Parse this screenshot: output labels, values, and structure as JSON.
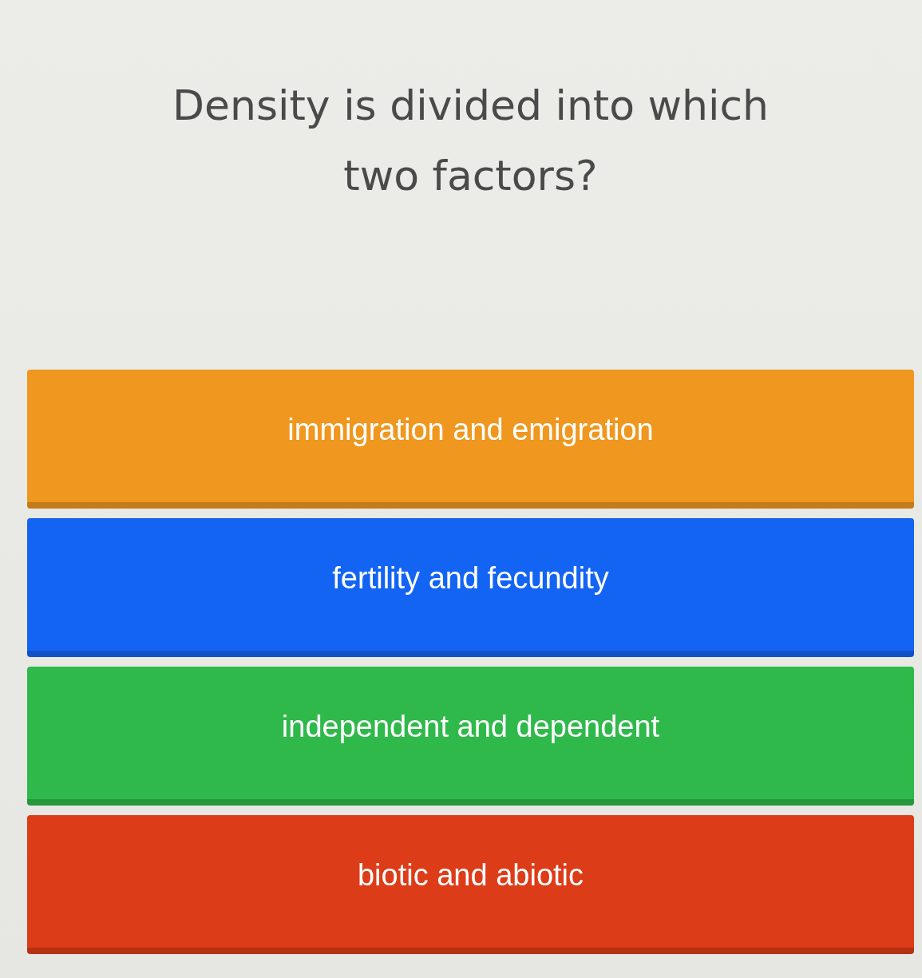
{
  "question": "Density is divided into which two factors?",
  "answers": [
    {
      "label": "immigration and emigration",
      "color": "#ef971f"
    },
    {
      "label": "fertility and fecundity",
      "color": "#1464f4"
    },
    {
      "label": "independent and dependent",
      "color": "#2fb94a"
    },
    {
      "label": "biotic and abiotic",
      "color": "#dd3c18"
    }
  ]
}
